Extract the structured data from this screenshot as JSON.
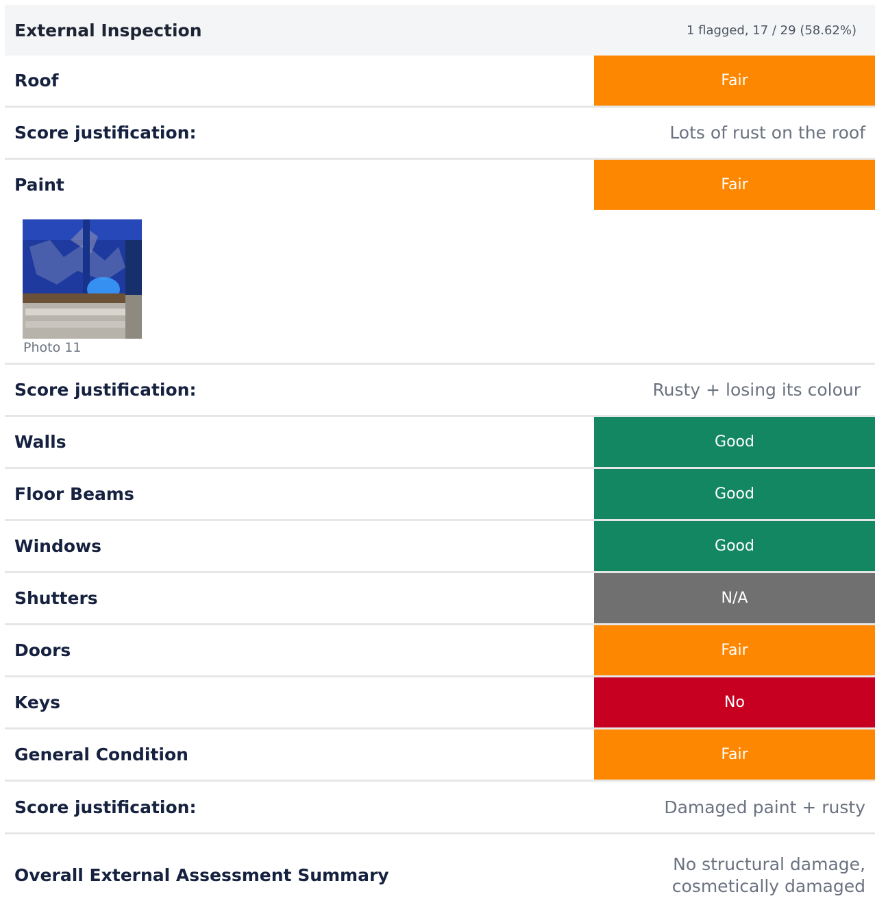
{
  "section": {
    "title": "External Inspection",
    "summary": "1 flagged, 17 / 29 (58.62%)"
  },
  "colors": {
    "fair": "#fe8701",
    "good": "#138762",
    "na": "#707070",
    "no": "#c70021"
  },
  "items": {
    "roof": {
      "label": "Roof",
      "rating": "Fair"
    },
    "roof_justification": {
      "label": "Score justification:",
      "value": "Lots of rust on the roof"
    },
    "paint": {
      "label": "Paint",
      "rating": "Fair",
      "photo_caption": "Photo 11"
    },
    "paint_justification": {
      "label": "Score justification:",
      "value": "Rusty + losing its colour"
    },
    "walls": {
      "label": "Walls",
      "rating": "Good"
    },
    "floor_beams": {
      "label": "Floor Beams",
      "rating": "Good"
    },
    "windows": {
      "label": "Windows",
      "rating": "Good"
    },
    "shutters": {
      "label": "Shutters",
      "rating": "N/A"
    },
    "doors": {
      "label": "Doors",
      "rating": "Fair"
    },
    "keys": {
      "label": "Keys",
      "rating": "No"
    },
    "general_condition": {
      "label": "General Condition",
      "rating": "Fair"
    },
    "general_justification": {
      "label": "Score justification:",
      "value": "Damaged paint + rusty"
    },
    "overall_summary": {
      "label": "Overall External Assessment Summary",
      "value_line1": "No structural damage,",
      "value_line2": "cosmetically damaged"
    }
  }
}
